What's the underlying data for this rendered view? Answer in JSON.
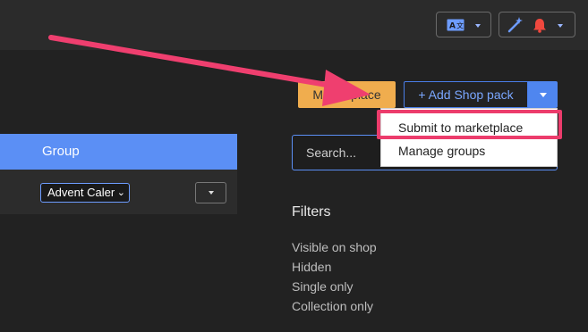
{
  "topbar": {
    "translate_icon": "translate-icon",
    "magic_icon": "magic-wand-icon",
    "bell_icon": "bell-icon",
    "colors": {
      "icon_blue": "#6d9cff",
      "bell_red": "#f0483e"
    }
  },
  "panel": {
    "header": "Group",
    "select_value": "Advent Caler"
  },
  "toolbar": {
    "marketplace_label": "Marketplace",
    "add_shop_pack_label": "+ Add Shop pack"
  },
  "dropdown": {
    "items": [
      "Submit to marketplace",
      "Manage groups"
    ]
  },
  "search": {
    "placeholder": "Search..."
  },
  "filters": {
    "title": "Filters",
    "items": [
      "Visible on shop",
      "Hidden",
      "Single only",
      "Collection only"
    ]
  },
  "annotation": {
    "arrow_color": "#ef3f6f",
    "highlight_color": "#ec3c6c"
  }
}
